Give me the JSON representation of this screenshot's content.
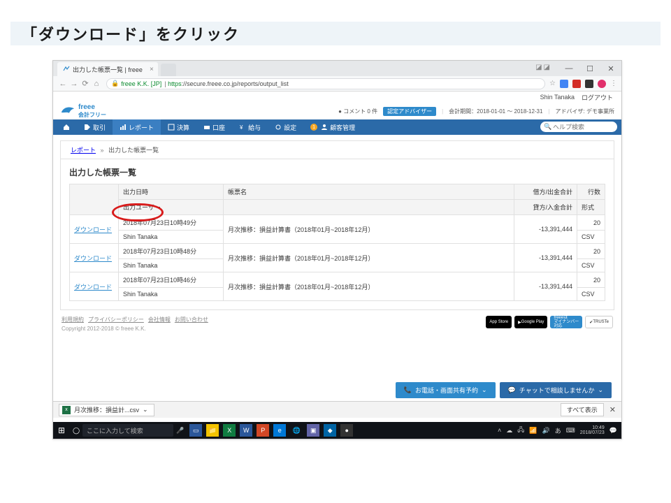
{
  "slide": {
    "title": "「ダウンロード」をクリック"
  },
  "browser": {
    "tab": {
      "title": "出力した帳票一覧 | freee"
    },
    "win": {
      "min": "—",
      "max": "☐",
      "close": "✕"
    },
    "incognito": "◪◪",
    "nav": {
      "back": "←",
      "fwd": "→",
      "reload": "⟳",
      "home": "⌂"
    },
    "omnibox": {
      "lock": "🔒",
      "org": "freee K.K. [JP]",
      "https": "https",
      "rest": "://secure.freee.co.jp/reports/output_list"
    },
    "ext": {
      "star": "☆",
      "g": "G",
      "lp": "■",
      "j": "❏",
      "o": "◎",
      "menu": "⋮"
    }
  },
  "userbar": {
    "name": "Shin Tanaka",
    "logout": "ログアウト"
  },
  "logo": {
    "brand": "freee",
    "sub": "会計フリー"
  },
  "meta": {
    "comment_prefix": "● コメント 0 件",
    "badge": "認定アドバイザー",
    "period": "会計期間：2018-01-01 ～ 2018-12-31",
    "office": "アドバイザ: デモ事業所"
  },
  "navitems": [
    {
      "icon": "home",
      "label": ""
    },
    {
      "icon": "torihiki",
      "label": "取引"
    },
    {
      "icon": "report",
      "label": "レポート",
      "active": true
    },
    {
      "icon": "kessan",
      "label": "決算"
    },
    {
      "icon": "koza",
      "label": "口座"
    },
    {
      "icon": "kyuyo",
      "label": "給与"
    },
    {
      "icon": "settei",
      "label": "設定"
    },
    {
      "icon": "kokyaku",
      "label": "顧客管理",
      "badge": "1"
    }
  ],
  "search_placeholder": "ヘルプ検索",
  "breadcrumb": {
    "a": "レポート",
    "sep": "»",
    "b": "出力した帳票一覧"
  },
  "panel_title": "出力した帳票一覧",
  "headers": {
    "col1": "",
    "date": "出力日時",
    "user": "出力ユーザー",
    "name": "帳票名",
    "debit": "借方/出金合計",
    "credit": "貸方/入金合計",
    "rows": "行数",
    "fmt": "形式"
  },
  "rows": [
    {
      "dl": "ダウンロード",
      "date": "2018年07月23日10時49分",
      "user": "Shin Tanaka",
      "name": "月次推移：損益計算書（2018年01月~2018年12月）",
      "credit": "-13,391,444",
      "rows": "20",
      "fmt": "CSV"
    },
    {
      "dl": "ダウンロード",
      "date": "2018年07月23日10時48分",
      "user": "Shin Tanaka",
      "name": "月次推移：損益計算書（2018年01月~2018年12月）",
      "credit": "-13,391,444",
      "rows": "20",
      "fmt": "CSV"
    },
    {
      "dl": "ダウンロード",
      "date": "2018年07月23日10時46分",
      "user": "Shin Tanaka",
      "name": "月次推移：損益計算書（2018年01月~2018年12月）",
      "credit": "-13,391,444",
      "rows": "20",
      "fmt": "CSV"
    }
  ],
  "footer": {
    "links": [
      "利用規約",
      "プライバシーポリシー",
      "会社情報",
      "お問い合わせ"
    ],
    "copyright": "Copyright 2012-2018 © freee K.K.",
    "stores": {
      "app": "App Store",
      "gp": "Google Play",
      "my": "freeeは\nマイナンバー\n対応",
      "tr": "TRUSTe"
    }
  },
  "float": {
    "tel": "お電話・画面共有予約",
    "chat": "チャットで相談しませんか",
    "chev": "⌄"
  },
  "dlbar": {
    "file": "月次推移：損益計...csv",
    "chev": "⌄",
    "all": "すべて表示",
    "x": "✕"
  },
  "taskbar": {
    "start": "⊞",
    "cortana": "◯",
    "search": "ここに入力して検索",
    "mic": "🎤",
    "tray": {
      "up": "˄",
      "cloud": "☁",
      "wifi": "📶",
      "net": "🖧",
      "vol": "🔊",
      "ime": "あ",
      "kb": "⌨",
      "time": "10:49",
      "date": "2018/07/23",
      "notif": "💬"
    }
  }
}
